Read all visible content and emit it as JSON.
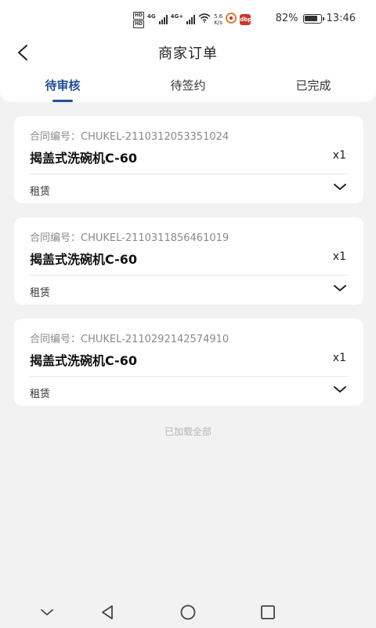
{
  "status_bar": {
    "hd_top": "HD",
    "hd_bottom": "HD",
    "net1": "4G",
    "net2": "4G+",
    "speed_value": "5.6",
    "speed_unit": "K/s",
    "badge_app": "dbp",
    "battery_percent": "82%",
    "battery_level": 0.82,
    "time": "13:46"
  },
  "header": {
    "title": "商家订单"
  },
  "tabs": [
    {
      "label": "待审核",
      "active": true
    },
    {
      "label": "待签约",
      "active": false
    },
    {
      "label": "已完成",
      "active": false
    }
  ],
  "orders": [
    {
      "contract_label": "合同编号：",
      "contract_no": "CHUKEL-2110312053351024",
      "product": "揭盖式洗碗机C-60",
      "quantity": "x1",
      "type": "租赁"
    },
    {
      "contract_label": "合同编号：",
      "contract_no": "CHUKEL-2110311856461019",
      "product": "揭盖式洗碗机C-60",
      "quantity": "x1",
      "type": "租赁"
    },
    {
      "contract_label": "合同编号：",
      "contract_no": "CHUKEL-2110292142574910",
      "product": "揭盖式洗碗机C-60",
      "quantity": "x1",
      "type": "租赁"
    }
  ],
  "footer_text": "已加载全部",
  "colors": {
    "accent": "#1f4f93",
    "background": "#f2f2f2",
    "card": "#ffffff"
  }
}
